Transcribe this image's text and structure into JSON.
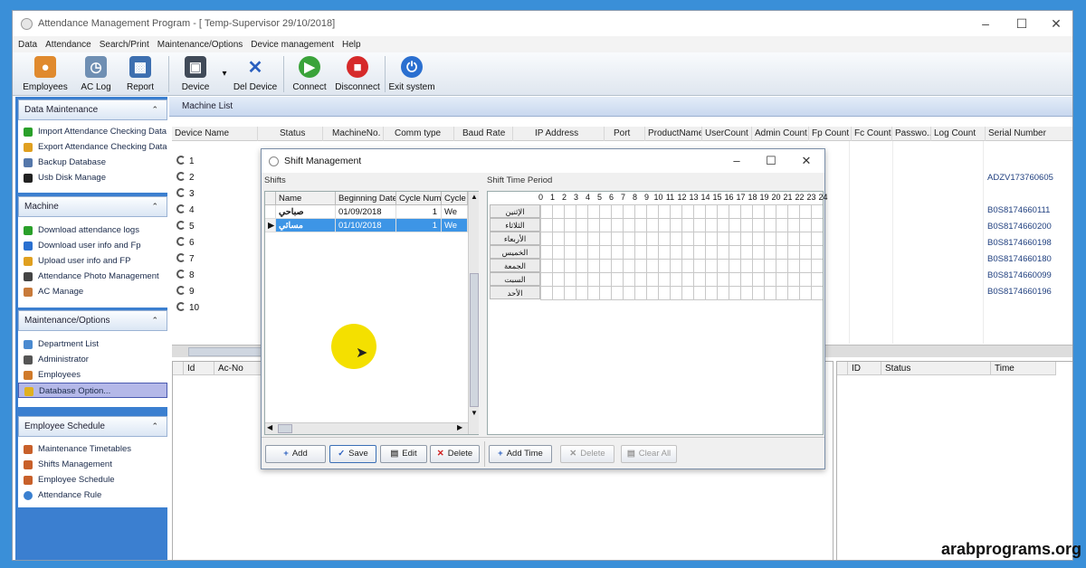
{
  "window": {
    "title": "Attendance Management Program - [ Temp-Supervisor 29/10/2018]"
  },
  "menu": [
    "Data",
    "Attendance",
    "Search/Print",
    "Maintenance/Options",
    "Device management",
    "Help"
  ],
  "toolbar": {
    "employees": "Employees",
    "ac_log": "AC Log",
    "report": "Report",
    "device": "Device",
    "del_device": "Del Device",
    "connect": "Connect",
    "disconnect": "Disconnect",
    "exit": "Exit system"
  },
  "sidebar": {
    "data_maintenance": {
      "title": "Data Maintenance",
      "items": [
        "Import Attendance Checking Data",
        "Export Attendance Checking Data",
        "Backup Database",
        "Usb Disk Manage"
      ]
    },
    "machine": {
      "title": "Machine",
      "items": [
        "Download attendance logs",
        "Download user info and Fp",
        "Upload user info and FP",
        "Attendance Photo Management",
        "AC Manage"
      ]
    },
    "maintenance": {
      "title": "Maintenance/Options",
      "items": [
        "Department List",
        "Administrator",
        "Employees",
        "Database Option..."
      ]
    },
    "schedule": {
      "title": "Employee Schedule",
      "items": [
        "Maintenance Timetables",
        "Shifts Management",
        "Employee Schedule",
        "Attendance Rule"
      ]
    }
  },
  "machine_list": {
    "title": "Machine List",
    "columns": [
      "Device Name",
      "Status",
      "MachineNo.",
      "Comm type",
      "Baud Rate",
      "IP Address",
      "Port",
      "ProductName",
      "UserCount",
      "Admin Count",
      "Fp Count",
      "Fc Count",
      "Passwo...",
      "Log Count",
      "Serial Number"
    ],
    "rows": [
      "1",
      "2",
      "3",
      "4",
      "5",
      "6",
      "7",
      "8",
      "9",
      "10"
    ],
    "serials": [
      "",
      "ADZV173760605",
      "",
      "B0S8174660111",
      "B0S8174660200",
      "B0S8174660198",
      "B0S8174660180",
      "B0S8174660099",
      "B0S8174660196",
      ""
    ]
  },
  "lower_left": {
    "columns": [
      "Id",
      "Ac-No"
    ]
  },
  "lower_right": {
    "columns": [
      "ID",
      "Status",
      "Time"
    ]
  },
  "dialog": {
    "title": "Shift Management",
    "shifts_label": "Shifts",
    "period_label": "Shift Time Period",
    "columns": [
      "Name",
      "Beginning Date",
      "Cycle Num",
      "Cycle"
    ],
    "rows": [
      {
        "name": "صباحي",
        "date": "01/09/2018",
        "num": "1",
        "cycle": "We"
      },
      {
        "name": "مسائي",
        "date": "01/10/2018",
        "num": "1",
        "cycle": "We"
      }
    ],
    "hours": [
      "0",
      "1",
      "2",
      "3",
      "4",
      "5",
      "6",
      "7",
      "8",
      "9",
      "10",
      "11",
      "12",
      "13",
      "14",
      "15",
      "16",
      "17",
      "18",
      "19",
      "20",
      "21",
      "22",
      "23",
      "24"
    ],
    "days": [
      "الإثنين",
      "الثلاثاء",
      "الأربعاء",
      "الخميس",
      "الجمعة",
      "السبت",
      "الأحد"
    ],
    "buttons": {
      "add": "Add",
      "save": "Save",
      "edit": "Edit",
      "delete": "Delete",
      "add_time": "Add Time",
      "delete_time": "Delete",
      "clear_all": "Clear All"
    }
  },
  "watermark": "arabprograms.org"
}
